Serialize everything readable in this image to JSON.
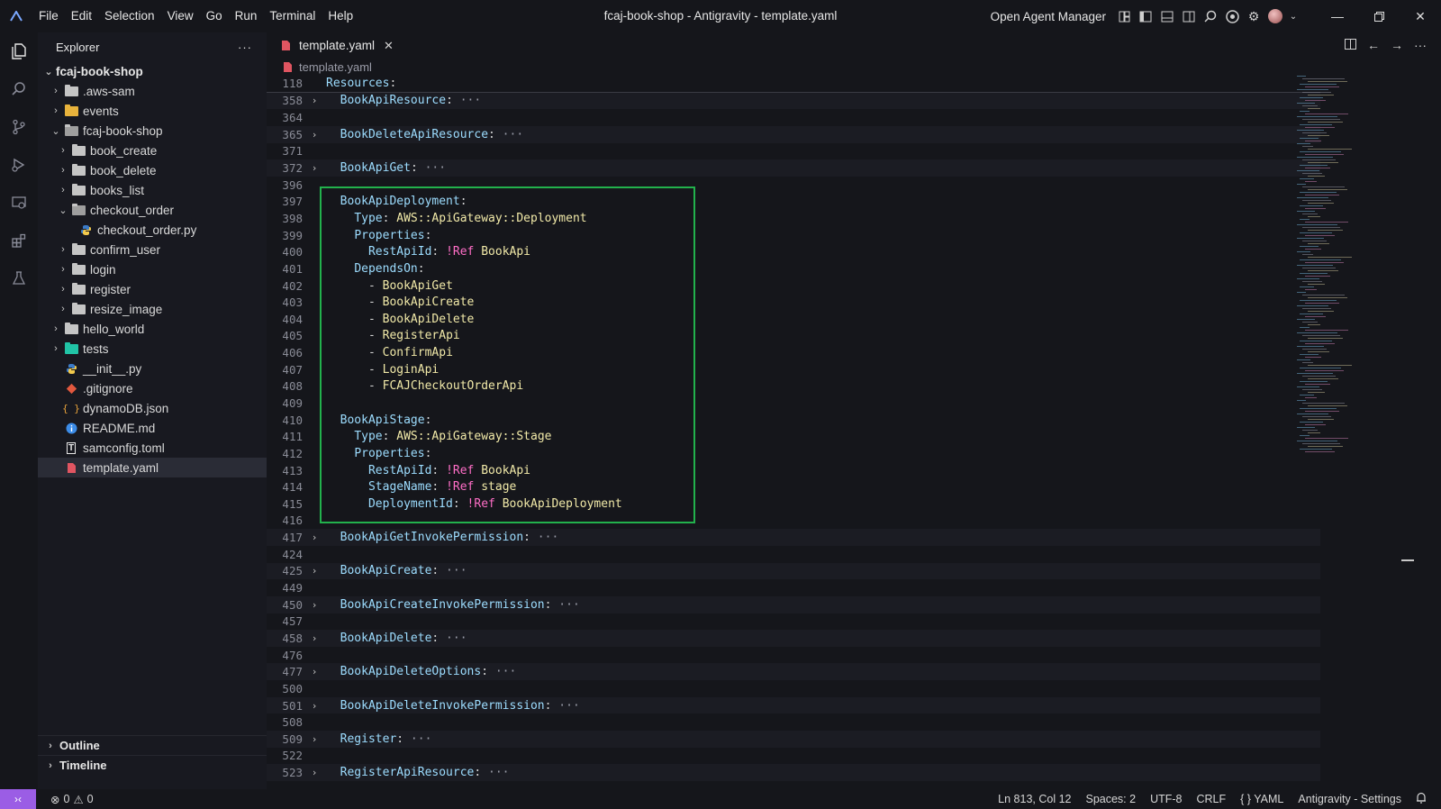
{
  "titlebar": {
    "menu": [
      "File",
      "Edit",
      "Selection",
      "View",
      "Go",
      "Run",
      "Terminal",
      "Help"
    ],
    "window_title": "fcaj-book-shop - Antigravity - template.yaml",
    "agent_manager": "Open Agent Manager"
  },
  "activity": [
    "explorer-icon",
    "search-icon",
    "source-control-icon",
    "run-debug-icon",
    "remote-explorer-icon",
    "extensions-icon",
    "testing-icon"
  ],
  "explorer": {
    "title": "Explorer",
    "more": "···",
    "root": "fcaj-book-shop",
    "items": [
      {
        "label": ".aws-sam",
        "kind": "folder",
        "depth": 1,
        "chevron": "closed"
      },
      {
        "label": "events",
        "kind": "folder-yellow",
        "depth": 1,
        "chevron": "closed"
      },
      {
        "label": "fcaj-book-shop",
        "kind": "folder-open",
        "depth": 1,
        "chevron": "open"
      },
      {
        "label": "book_create",
        "kind": "folder",
        "depth": 2,
        "chevron": "closed"
      },
      {
        "label": "book_delete",
        "kind": "folder",
        "depth": 2,
        "chevron": "closed"
      },
      {
        "label": "books_list",
        "kind": "folder",
        "depth": 2,
        "chevron": "closed"
      },
      {
        "label": "checkout_order",
        "kind": "folder-open",
        "depth": 2,
        "chevron": "open"
      },
      {
        "label": "checkout_order.py",
        "kind": "python",
        "depth": 3,
        "chevron": ""
      },
      {
        "label": "confirm_user",
        "kind": "folder",
        "depth": 2,
        "chevron": "closed"
      },
      {
        "label": "login",
        "kind": "folder",
        "depth": 2,
        "chevron": "closed"
      },
      {
        "label": "register",
        "kind": "folder",
        "depth": 2,
        "chevron": "closed"
      },
      {
        "label": "resize_image",
        "kind": "folder",
        "depth": 2,
        "chevron": "closed"
      },
      {
        "label": "hello_world",
        "kind": "folder",
        "depth": 1,
        "chevron": "closed"
      },
      {
        "label": "tests",
        "kind": "folder-teal",
        "depth": 1,
        "chevron": "closed"
      },
      {
        "label": "__init__.py",
        "kind": "python",
        "depth": 1,
        "chevron": ""
      },
      {
        "label": ".gitignore",
        "kind": "git",
        "depth": 1,
        "chevron": ""
      },
      {
        "label": "dynamoDB.json",
        "kind": "json",
        "depth": 1,
        "chevron": ""
      },
      {
        "label": "README.md",
        "kind": "info",
        "depth": 1,
        "chevron": ""
      },
      {
        "label": "samconfig.toml",
        "kind": "toml",
        "depth": 1,
        "chevron": ""
      },
      {
        "label": "template.yaml",
        "kind": "yaml",
        "depth": 1,
        "chevron": "",
        "selected": true
      }
    ],
    "outline": "Outline",
    "timeline": "Timeline"
  },
  "editor": {
    "tab": "template.yaml",
    "breadcrumb": "template.yaml",
    "lines": [
      {
        "n": "118",
        "fold": "",
        "sticky": true,
        "tokens": [
          [
            "k",
            "Resources"
          ],
          [
            "p",
            ":"
          ]
        ]
      },
      {
        "n": "358",
        "fold": ">",
        "folded": true,
        "tokens": [
          [
            "p",
            "  "
          ],
          [
            "k",
            "BookApiResource"
          ],
          [
            "p",
            ":"
          ],
          [
            "ell",
            " ···"
          ]
        ]
      },
      {
        "n": "364",
        "fold": "",
        "tokens": []
      },
      {
        "n": "365",
        "fold": ">",
        "folded": true,
        "tokens": [
          [
            "p",
            "  "
          ],
          [
            "k",
            "BookDeleteApiResource"
          ],
          [
            "p",
            ":"
          ],
          [
            "ell",
            " ···"
          ]
        ]
      },
      {
        "n": "371",
        "fold": "",
        "tokens": []
      },
      {
        "n": "372",
        "fold": ">",
        "folded": true,
        "tokens": [
          [
            "p",
            "  "
          ],
          [
            "k",
            "BookApiGet"
          ],
          [
            "p",
            ":"
          ],
          [
            "ell",
            " ···"
          ]
        ]
      },
      {
        "n": "396",
        "fold": "",
        "tokens": []
      },
      {
        "n": "397",
        "fold": "",
        "tokens": [
          [
            "p",
            "  "
          ],
          [
            "k",
            "BookApiDeployment"
          ],
          [
            "p",
            ":"
          ]
        ]
      },
      {
        "n": "398",
        "fold": "",
        "tokens": [
          [
            "p",
            "    "
          ],
          [
            "k",
            "Type"
          ],
          [
            "p",
            ": "
          ],
          [
            "v",
            "AWS::ApiGateway::Deployment"
          ]
        ]
      },
      {
        "n": "399",
        "fold": "",
        "tokens": [
          [
            "p",
            "    "
          ],
          [
            "k",
            "Properties"
          ],
          [
            "p",
            ":"
          ]
        ]
      },
      {
        "n": "400",
        "fold": "",
        "tokens": [
          [
            "p",
            "      "
          ],
          [
            "k",
            "RestApiId"
          ],
          [
            "p",
            ": "
          ],
          [
            "r",
            "!Ref"
          ],
          [
            "p",
            " "
          ],
          [
            "v",
            "BookApi"
          ]
        ]
      },
      {
        "n": "401",
        "fold": "",
        "tokens": [
          [
            "p",
            "    "
          ],
          [
            "k",
            "DependsOn"
          ],
          [
            "p",
            ":"
          ]
        ]
      },
      {
        "n": "402",
        "fold": "",
        "tokens": [
          [
            "p",
            "      - "
          ],
          [
            "v",
            "BookApiGet"
          ]
        ]
      },
      {
        "n": "403",
        "fold": "",
        "tokens": [
          [
            "p",
            "      - "
          ],
          [
            "v",
            "BookApiCreate"
          ]
        ]
      },
      {
        "n": "404",
        "fold": "",
        "tokens": [
          [
            "p",
            "      - "
          ],
          [
            "v",
            "BookApiDelete"
          ]
        ]
      },
      {
        "n": "405",
        "fold": "",
        "tokens": [
          [
            "p",
            "      - "
          ],
          [
            "v",
            "RegisterApi"
          ]
        ]
      },
      {
        "n": "406",
        "fold": "",
        "tokens": [
          [
            "p",
            "      - "
          ],
          [
            "v",
            "ConfirmApi"
          ]
        ]
      },
      {
        "n": "407",
        "fold": "",
        "tokens": [
          [
            "p",
            "      - "
          ],
          [
            "v",
            "LoginApi"
          ]
        ]
      },
      {
        "n": "408",
        "fold": "",
        "tokens": [
          [
            "p",
            "      - "
          ],
          [
            "v",
            "FCAJCheckoutOrderApi"
          ]
        ]
      },
      {
        "n": "409",
        "fold": "",
        "tokens": []
      },
      {
        "n": "410",
        "fold": "",
        "tokens": [
          [
            "p",
            "  "
          ],
          [
            "k",
            "BookApiStage"
          ],
          [
            "p",
            ":"
          ]
        ]
      },
      {
        "n": "411",
        "fold": "",
        "tokens": [
          [
            "p",
            "    "
          ],
          [
            "k",
            "Type"
          ],
          [
            "p",
            ": "
          ],
          [
            "v",
            "AWS::ApiGateway::Stage"
          ]
        ]
      },
      {
        "n": "412",
        "fold": "",
        "tokens": [
          [
            "p",
            "    "
          ],
          [
            "k",
            "Properties"
          ],
          [
            "p",
            ":"
          ]
        ]
      },
      {
        "n": "413",
        "fold": "",
        "tokens": [
          [
            "p",
            "      "
          ],
          [
            "k",
            "RestApiId"
          ],
          [
            "p",
            ": "
          ],
          [
            "r",
            "!Ref"
          ],
          [
            "p",
            " "
          ],
          [
            "v",
            "BookApi"
          ]
        ]
      },
      {
        "n": "414",
        "fold": "",
        "tokens": [
          [
            "p",
            "      "
          ],
          [
            "k",
            "StageName"
          ],
          [
            "p",
            ": "
          ],
          [
            "r",
            "!Ref"
          ],
          [
            "p",
            " "
          ],
          [
            "v",
            "stage"
          ]
        ]
      },
      {
        "n": "415",
        "fold": "",
        "tokens": [
          [
            "p",
            "      "
          ],
          [
            "k",
            "DeploymentId"
          ],
          [
            "p",
            ": "
          ],
          [
            "r",
            "!Ref"
          ],
          [
            "p",
            " "
          ],
          [
            "v",
            "BookApiDeployment"
          ]
        ]
      },
      {
        "n": "416",
        "fold": "",
        "tokens": []
      },
      {
        "n": "417",
        "fold": ">",
        "folded": true,
        "tokens": [
          [
            "p",
            "  "
          ],
          [
            "k",
            "BookApiGetInvokePermission"
          ],
          [
            "p",
            ":"
          ],
          [
            "ell",
            " ···"
          ]
        ]
      },
      {
        "n": "424",
        "fold": "",
        "tokens": []
      },
      {
        "n": "425",
        "fold": ">",
        "folded": true,
        "tokens": [
          [
            "p",
            "  "
          ],
          [
            "k",
            "BookApiCreate"
          ],
          [
            "p",
            ":"
          ],
          [
            "ell",
            " ···"
          ]
        ]
      },
      {
        "n": "449",
        "fold": "",
        "tokens": []
      },
      {
        "n": "450",
        "fold": ">",
        "folded": true,
        "tokens": [
          [
            "p",
            "  "
          ],
          [
            "k",
            "BookApiCreateInvokePermission"
          ],
          [
            "p",
            ":"
          ],
          [
            "ell",
            " ···"
          ]
        ]
      },
      {
        "n": "457",
        "fold": "",
        "tokens": []
      },
      {
        "n": "458",
        "fold": ">",
        "folded": true,
        "tokens": [
          [
            "p",
            "  "
          ],
          [
            "k",
            "BookApiDelete"
          ],
          [
            "p",
            ":"
          ],
          [
            "ell",
            " ···"
          ]
        ]
      },
      {
        "n": "476",
        "fold": "",
        "tokens": []
      },
      {
        "n": "477",
        "fold": ">",
        "folded": true,
        "tokens": [
          [
            "p",
            "  "
          ],
          [
            "k",
            "BookApiDeleteOptions"
          ],
          [
            "p",
            ":"
          ],
          [
            "ell",
            " ···"
          ]
        ]
      },
      {
        "n": "500",
        "fold": "",
        "tokens": []
      },
      {
        "n": "501",
        "fold": ">",
        "folded": true,
        "tokens": [
          [
            "p",
            "  "
          ],
          [
            "k",
            "BookApiDeleteInvokePermission"
          ],
          [
            "p",
            ":"
          ],
          [
            "ell",
            " ···"
          ]
        ]
      },
      {
        "n": "508",
        "fold": "",
        "tokens": []
      },
      {
        "n": "509",
        "fold": ">",
        "folded": true,
        "tokens": [
          [
            "p",
            "  "
          ],
          [
            "k",
            "Register"
          ],
          [
            "p",
            ":"
          ],
          [
            "ell",
            " ···"
          ]
        ]
      },
      {
        "n": "522",
        "fold": "",
        "tokens": []
      },
      {
        "n": "523",
        "fold": ">",
        "folded": true,
        "tokens": [
          [
            "p",
            "  "
          ],
          [
            "k",
            "RegisterApiResource"
          ],
          [
            "p",
            ":"
          ],
          [
            "ell",
            " ···"
          ]
        ]
      }
    ]
  },
  "status": {
    "errors": "0",
    "warnings": "0",
    "position": "Ln 813, Col 12",
    "spaces": "Spaces: 2",
    "encoding": "UTF-8",
    "eol": "CRLF",
    "language": "YAML",
    "settings": "Antigravity - Settings"
  },
  "colors": {
    "accent_remote": "#9b5de5",
    "highlight_box": "#22b14c",
    "yaml_key": "#9cdcfe",
    "yaml_value": "#f1e9a8",
    "yaml_tag": "#ff6ec7"
  }
}
